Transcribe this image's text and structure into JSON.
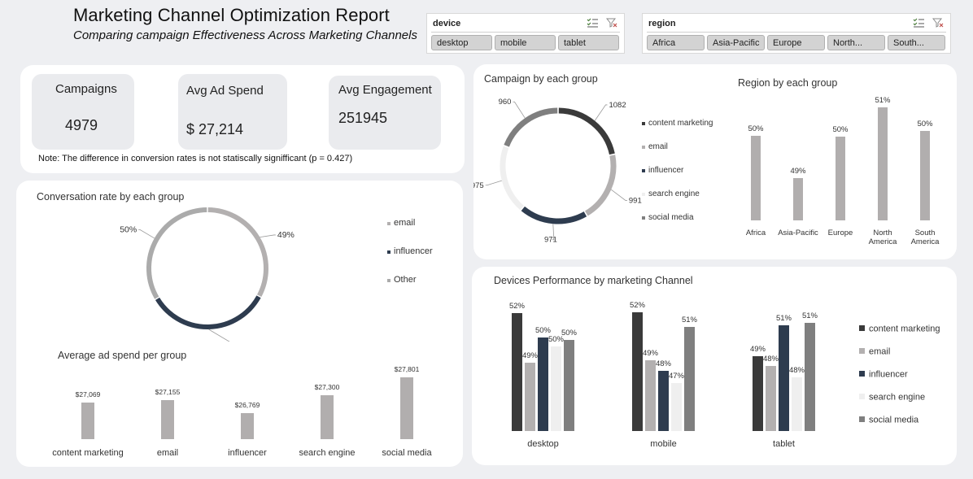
{
  "header": {
    "title": "Marketing Channel Optimization Report",
    "subtitle": "Comparing campaign Effectiveness Across Marketing Channels"
  },
  "slicers": {
    "device": {
      "label": "device",
      "items": [
        "desktop",
        "mobile",
        "tablet"
      ]
    },
    "region": {
      "label": "region",
      "items": [
        "Africa",
        "Asia-Pacific",
        "Europe",
        "North...",
        "South..."
      ]
    }
  },
  "kpis": {
    "campaigns": {
      "label": "Campaigns",
      "value": "4979"
    },
    "avg_ad_spend": {
      "label": "Avg Ad Spend",
      "value": "$ 27,214"
    },
    "avg_engagement": {
      "label": "Avg Engagement",
      "value": "251945"
    },
    "note": "Note: The difference in conversion rates is not statiscally signifficant (p = 0.427)"
  },
  "colors": {
    "content_marketing": "#3a3a3a",
    "email": "#b3b0b0",
    "influencer": "#2e3c4f",
    "search_engine": "#efefef",
    "social_media": "#7f7f7f",
    "neutral_bar": "#b1aeae",
    "other": "#ababab"
  },
  "chart_data": [
    {
      "id": "campaign_by_group",
      "type": "pie",
      "title": "Campaign by each group",
      "categories": [
        "content marketing",
        "email",
        "influencer",
        "search engine",
        "social media"
      ],
      "values": [
        1082,
        991,
        971,
        975,
        960
      ],
      "value_labels": [
        "1082",
        "991",
        "971",
        "975",
        "960"
      ],
      "legend": "right"
    },
    {
      "id": "region_by_group",
      "type": "bar",
      "title": "Region by each group",
      "categories": [
        "Africa",
        "Asia-Pacific",
        "Europe",
        "North America",
        "South America"
      ],
      "values": [
        50,
        49,
        50,
        51,
        50
      ],
      "value_labels": [
        "50%",
        "49%",
        "50%",
        "51%",
        "50%"
      ]
    },
    {
      "id": "conversion_by_group",
      "type": "pie",
      "title": "Conversation rate by each group",
      "categories": [
        "email",
        "influencer",
        "Other"
      ],
      "values": [
        49,
        50,
        50
      ],
      "value_labels": [
        "49%",
        "50%",
        "50%"
      ],
      "legend": "right"
    },
    {
      "id": "ad_spend_by_group",
      "type": "bar",
      "title": "Average ad spend per group",
      "categories": [
        "content marketing",
        "email",
        "influencer",
        "search engine",
        "social media"
      ],
      "values": [
        27069,
        27155,
        26769,
        27300,
        27801
      ],
      "value_labels": [
        "$27,069",
        "$27,155",
        "$26,769",
        "$27,300",
        "$27,801"
      ]
    },
    {
      "id": "device_performance",
      "type": "bar",
      "title": "Devices Performance by marketing Channel",
      "categories": [
        "desktop",
        "mobile",
        "tablet"
      ],
      "series": [
        {
          "name": "content marketing",
          "values": [
            52,
            52,
            49
          ],
          "labels": [
            "52%",
            "52%",
            "49%"
          ]
        },
        {
          "name": "email",
          "values": [
            49,
            49,
            48
          ],
          "labels": [
            "49%",
            "49%",
            "48%"
          ]
        },
        {
          "name": "influencer",
          "values": [
            50,
            48,
            51
          ],
          "labels": [
            "50%",
            "48%",
            "51%"
          ]
        },
        {
          "name": "search engine",
          "values": [
            50,
            47,
            48
          ],
          "labels": [
            "50%",
            "47%",
            "48%"
          ]
        },
        {
          "name": "social media",
          "values": [
            50,
            51,
            51
          ],
          "labels": [
            "50%",
            "51%",
            "51%"
          ]
        }
      ],
      "legend": "right"
    }
  ]
}
